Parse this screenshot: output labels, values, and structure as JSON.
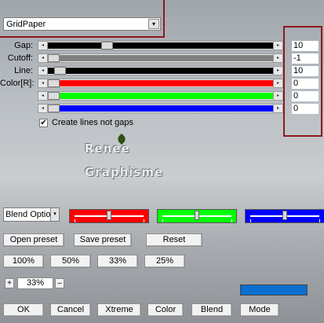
{
  "preset_dropdown": {
    "value": "GridPaper"
  },
  "sliders": [
    {
      "label": "Gap:",
      "value": "10",
      "track_color": "#000000",
      "level": 0.25
    },
    {
      "label": "Cutoff:",
      "value": "-1",
      "track_color": "#808080",
      "level": 0.0
    },
    {
      "label": "Line:",
      "value": "10",
      "track_color": "#000000",
      "level": 0.03
    },
    {
      "label": "Color[R]:",
      "value": "0",
      "track_color": "#ff0000",
      "level": 0.0
    },
    {
      "label": "",
      "value": "0",
      "track_color": "#00ff00",
      "level": 0.0
    },
    {
      "label": "",
      "value": "0",
      "track_color": "#0000ff",
      "level": 0.0
    }
  ],
  "checkbox": {
    "label": "Create lines not gaps",
    "checked": true,
    "mark": "✔"
  },
  "watermark": {
    "line1": "Renee",
    "line2": "Graphisme"
  },
  "blend_dropdown": {
    "value": "Blend Options"
  },
  "channels": [
    {
      "color": "#ff0000",
      "level": 0.5
    },
    {
      "color": "#00ff00",
      "level": 0.5
    },
    {
      "color": "#0000ff",
      "level": 0.5
    }
  ],
  "preset_buttons": {
    "open": "Open preset",
    "save": "Save preset",
    "reset": "Reset"
  },
  "zoom_buttons": [
    "100%",
    "50%",
    "33%",
    "25%"
  ],
  "zoom": {
    "plus": "+",
    "value": "33%",
    "minus": "–"
  },
  "preview_color": "#0a6fd1",
  "bottom_buttons": [
    "OK",
    "Cancel",
    "Xtreme",
    "Color",
    "Blend",
    "Mode"
  ],
  "icons": {
    "arrow_left": "◂",
    "arrow_right": "▸",
    "dropdown": "▾"
  }
}
